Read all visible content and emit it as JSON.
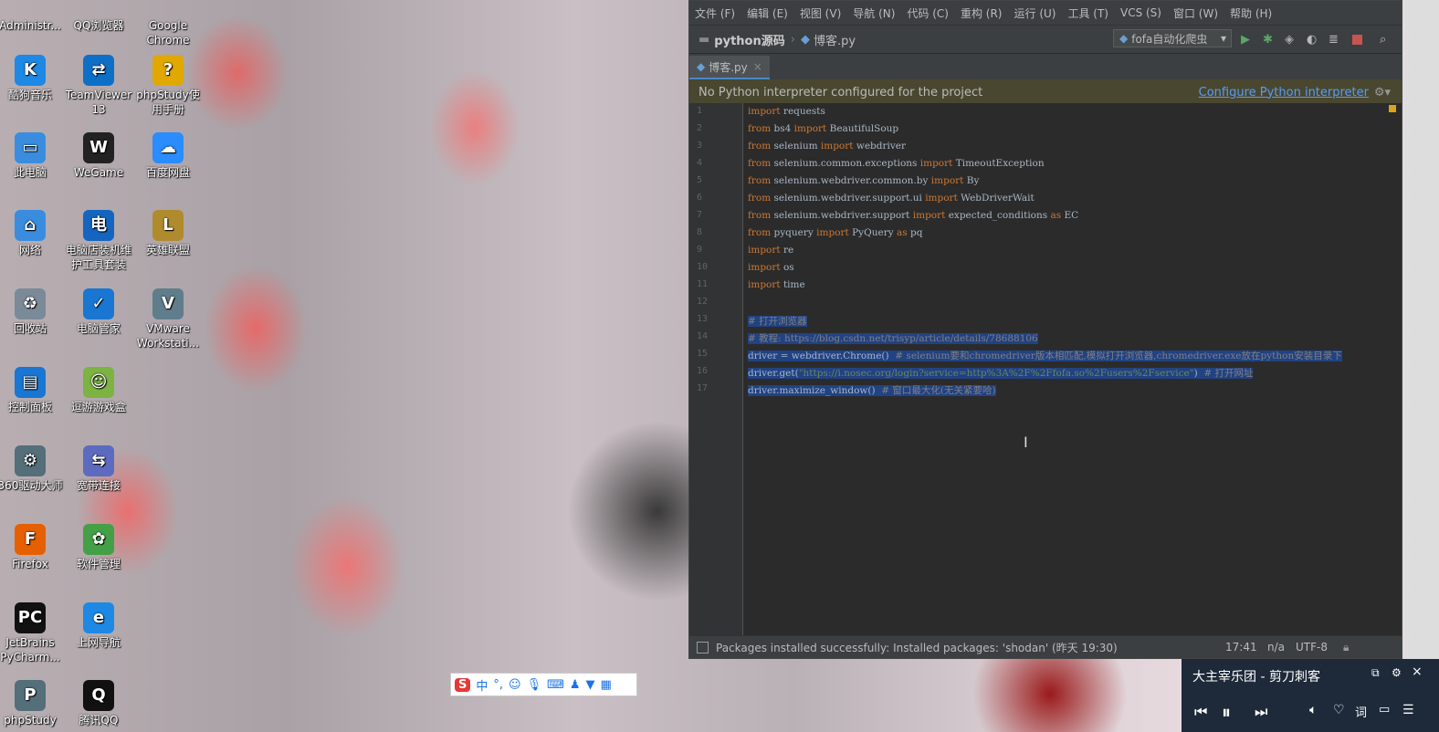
{
  "desktop": {
    "icons": [
      {
        "label": "Administr...",
        "glyph": "A",
        "color": "#3d6fb0"
      },
      {
        "label": "QQ浏览器",
        "glyph": "Q",
        "color": "#1e88e5"
      },
      {
        "label": "Google Chrome",
        "glyph": "G",
        "color": "#db4437"
      },
      {
        "label": "酷狗音乐",
        "glyph": "K",
        "color": "#1e88e5"
      },
      {
        "label": "TeamViewer 13",
        "glyph": "⇄",
        "color": "#0e6fc7"
      },
      {
        "label": "phpStudy使用手册",
        "glyph": "?",
        "color": "#e0a800"
      },
      {
        "label": "此电脑",
        "glyph": "▭",
        "color": "#3a8dde"
      },
      {
        "label": "WeGame",
        "glyph": "W",
        "color": "#222222"
      },
      {
        "label": "百度网盘",
        "glyph": "☁",
        "color": "#2a8cff"
      },
      {
        "label": "网络",
        "glyph": "⌂",
        "color": "#3a8dde"
      },
      {
        "label": "电脑店装机维护工具套装",
        "glyph": "电",
        "color": "#1565c0"
      },
      {
        "label": "英雄联盟",
        "glyph": "L",
        "color": "#b08b2e"
      },
      {
        "label": "回收站",
        "glyph": "♻",
        "color": "#7a8a99"
      },
      {
        "label": "电脑管家",
        "glyph": "✓",
        "color": "#1976d2"
      },
      {
        "label": "VMware Workstati...",
        "glyph": "V",
        "color": "#607d8b"
      },
      {
        "label": "控制面板",
        "glyph": "▤",
        "color": "#1976d2"
      },
      {
        "label": "逗游游戏盒",
        "glyph": "☺",
        "color": "#7cb342"
      },
      {
        "label": "360驱动大师",
        "glyph": "⚙",
        "color": "#546e7a"
      },
      {
        "label": "宽带连接",
        "glyph": "⇆",
        "color": "#5c6bc0"
      },
      {
        "label": "Firefox",
        "glyph": "F",
        "color": "#e66000"
      },
      {
        "label": "软件管理",
        "glyph": "✿",
        "color": "#43a047"
      },
      {
        "label": "JetBrains PyCharm...",
        "glyph": "PC",
        "color": "#111111"
      },
      {
        "label": "上网导航",
        "glyph": "e",
        "color": "#1e88e5"
      },
      {
        "label": "phpStudy",
        "glyph": "P",
        "color": "#546e7a"
      },
      {
        "label": "腾讯QQ",
        "glyph": "Q",
        "color": "#111111"
      }
    ]
  },
  "ide": {
    "menu": [
      "文件 (F)",
      "编辑 (E)",
      "视图 (V)",
      "导航 (N)",
      "代码 (C)",
      "重构 (R)",
      "运行 (U)",
      "工具 (T)",
      "VCS (S)",
      "窗口 (W)",
      "帮助 (H)"
    ],
    "breadcrumb": {
      "project": "python源码",
      "file": "博客.py"
    },
    "run_config": "fofa自动化爬虫",
    "tab": "博客.py",
    "banner": {
      "message": "No Python interpreter configured for the project",
      "link": "Configure Python interpreter"
    },
    "line_numbers": [
      "1",
      "2",
      "3",
      "4",
      "5",
      "6",
      "7",
      "8",
      "9",
      "10",
      "11",
      "12",
      "13",
      "14",
      "15",
      "16",
      "17"
    ],
    "code": [
      [
        {
          "t": "import",
          "c": "kw"
        },
        {
          "t": " requests",
          "c": ""
        }
      ],
      [
        {
          "t": "from",
          "c": "kw"
        },
        {
          "t": " bs4 ",
          "c": ""
        },
        {
          "t": "import",
          "c": "kw"
        },
        {
          "t": " BeautifulSoup",
          "c": ""
        }
      ],
      [
        {
          "t": "from",
          "c": "kw"
        },
        {
          "t": " selenium ",
          "c": ""
        },
        {
          "t": "import",
          "c": "kw"
        },
        {
          "t": " webdriver",
          "c": ""
        }
      ],
      [
        {
          "t": "from",
          "c": "kw"
        },
        {
          "t": " selenium.common.exceptions ",
          "c": ""
        },
        {
          "t": "import",
          "c": "kw"
        },
        {
          "t": " TimeoutException",
          "c": ""
        }
      ],
      [
        {
          "t": "from",
          "c": "kw"
        },
        {
          "t": " selenium.webdriver.common.by ",
          "c": ""
        },
        {
          "t": "import",
          "c": "kw"
        },
        {
          "t": " By",
          "c": ""
        }
      ],
      [
        {
          "t": "from",
          "c": "kw"
        },
        {
          "t": " selenium.webdriver.support.ui ",
          "c": ""
        },
        {
          "t": "import",
          "c": "kw"
        },
        {
          "t": " WebDriverWait",
          "c": ""
        }
      ],
      [
        {
          "t": "from",
          "c": "kw"
        },
        {
          "t": " selenium.webdriver.support ",
          "c": ""
        },
        {
          "t": "import",
          "c": "kw"
        },
        {
          "t": " expected_conditions ",
          "c": ""
        },
        {
          "t": "as",
          "c": "kw"
        },
        {
          "t": " EC",
          "c": ""
        }
      ],
      [
        {
          "t": "from",
          "c": "kw"
        },
        {
          "t": " pyquery ",
          "c": ""
        },
        {
          "t": "import",
          "c": "kw"
        },
        {
          "t": " PyQuery ",
          "c": ""
        },
        {
          "t": "as",
          "c": "kw"
        },
        {
          "t": " pq",
          "c": ""
        }
      ],
      [
        {
          "t": "import",
          "c": "kw"
        },
        {
          "t": " re",
          "c": ""
        }
      ],
      [
        {
          "t": "import",
          "c": "kw"
        },
        {
          "t": " os",
          "c": ""
        }
      ],
      [
        {
          "t": "import",
          "c": "kw"
        },
        {
          "t": " time",
          "c": ""
        }
      ],
      [],
      [
        {
          "t": "# 打开浏览器",
          "c": "cm sel"
        }
      ],
      [
        {
          "t": "# 教程: https://blog.csdn.net/trisyp/article/details/78688106",
          "c": "cm sel"
        }
      ],
      [
        {
          "t": "driver = webdriver.Chrome()  ",
          "c": "sel"
        },
        {
          "t": "# selenium要和chromedriver版本相匹配,模拟打开浏览器,chromedriver.exe放在python安装目录下",
          "c": "cm sel"
        }
      ],
      [
        {
          "t": "driver.get(",
          "c": "sel"
        },
        {
          "t": "\"https://i.nosec.org/login?service=http%3A%2F%2Ffofa.so%2Fusers%2Fservice\"",
          "c": "str sel"
        },
        {
          "t": ")  ",
          "c": "sel"
        },
        {
          "t": "# 打开网址",
          "c": "cm sel"
        }
      ],
      [
        {
          "t": "driver.maximize_window()  ",
          "c": "sel"
        },
        {
          "t": "# 窗口最大化(无关紧要哈)",
          "c": "cm sel"
        }
      ]
    ],
    "status": {
      "message": "Packages installed successfully: Installed packages: 'shodan' (昨天 19:30)",
      "position": "17:41",
      "na": "n/a",
      "encoding": "UTF-8"
    }
  },
  "ime": {
    "logo": "S",
    "mode": "中"
  },
  "music": {
    "title": "大主宰乐团 - 剪刀刺客"
  }
}
